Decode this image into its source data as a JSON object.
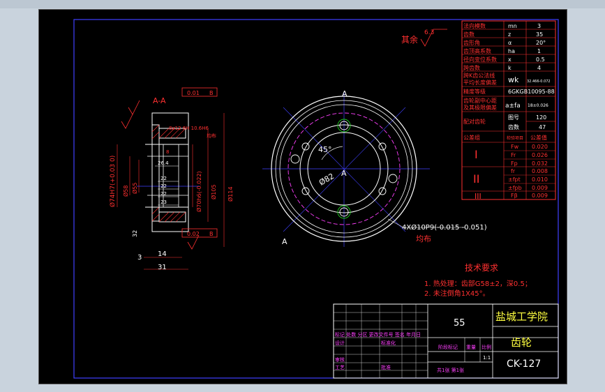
{
  "section_label": "A-A",
  "dims": {
    "tol_top": "0.01",
    "tol_top_ref": "B",
    "tol_bottom": "0.02",
    "tol_bottom_ref": "B",
    "d74": "Ø74H7(+0.03 0)",
    "d58": "Ø58",
    "d55": "Ø55",
    "d70": "Ø70h6(-0.022)",
    "d105": "Ø105",
    "d114": "Ø114",
    "w26": "26.4",
    "w22a": "22",
    "w22b": "22",
    "w22c": "22",
    "w23": "23",
    "dim3": "3",
    "dim14": "14",
    "dim31": "31",
    "dim32": "32",
    "keyway": "8x12 6H 10.6H6",
    "keyway2": "均布",
    "slot": "8",
    "ang45": "45°",
    "d82": "Ø82",
    "holes": "4XØ10P9(-0.015 -0.051)",
    "holes2": "均布",
    "view_a_top": "A",
    "view_a_left": "A",
    "view_a_center": "A",
    "roughness": "其余",
    "roughness_val": "6.3"
  },
  "params": [
    {
      "name": "法向模数",
      "sym": "mn",
      "val": "3"
    },
    {
      "name": "齿数",
      "sym": "z",
      "val": "35"
    },
    {
      "name": "齿形角",
      "sym": "α",
      "val": "20°"
    },
    {
      "name": "齿顶高系数",
      "sym": "ha",
      "val": "1"
    },
    {
      "name": "径向变位系数",
      "sym": "x",
      "val": "0.5"
    },
    {
      "name": "跨齿数",
      "sym": "k",
      "val": "4"
    }
  ],
  "params_wk": {
    "name1": "跨K齿公法线",
    "name2": "平均长度偏差",
    "sym": "wk",
    "val": "32.466-0.072"
  },
  "params_grade": {
    "name": "精度等级",
    "val": "6GKGB10095-88"
  },
  "params_center": {
    "name1": "齿轮副中心距",
    "name2": "及其极限偏差",
    "sym": "a±fa",
    "val": "18±0.026"
  },
  "pairing": {
    "name": "配对齿轮",
    "r1k": "图号",
    "r1v": "120",
    "r2k": "齿数",
    "r2v": "47"
  },
  "tolerance_header": {
    "group": "公差组",
    "code": "检验项目",
    "val": "公差值"
  },
  "tolerance_groups": [
    {
      "label": "I",
      "rows": [
        [
          "Fw",
          "0.020"
        ],
        [
          "Fr",
          "0.026"
        ],
        [
          "Fp",
          "0.032"
        ]
      ]
    },
    {
      "label": "II",
      "rows": [
        [
          "fr",
          "0.008"
        ],
        [
          "±fpt",
          "0.010"
        ],
        [
          "±fpb",
          "0.009"
        ]
      ]
    },
    {
      "label": "III",
      "rows": [
        [
          "Fβ",
          "0.009"
        ]
      ]
    }
  ],
  "tech": {
    "title": "技术要求",
    "line1": "1. 热处理：齿部G58±2，深0.5；",
    "line2": "2. 未注倒角1X45°。"
  },
  "title_block": {
    "material": "55",
    "school": "盐城工学院",
    "part": "齿轮",
    "drawing_no": "CK-127",
    "row_header": "标记 处数 分区 更改文件号 签名 年月日",
    "designer": "设计",
    "std": "标准化",
    "stage": "阶段标记",
    "weight": "重量",
    "scale_label": "比例",
    "scale": "1:1",
    "check": "审核",
    "craft": "工艺",
    "approve": "批准",
    "sheets": "共1张 第1张"
  }
}
